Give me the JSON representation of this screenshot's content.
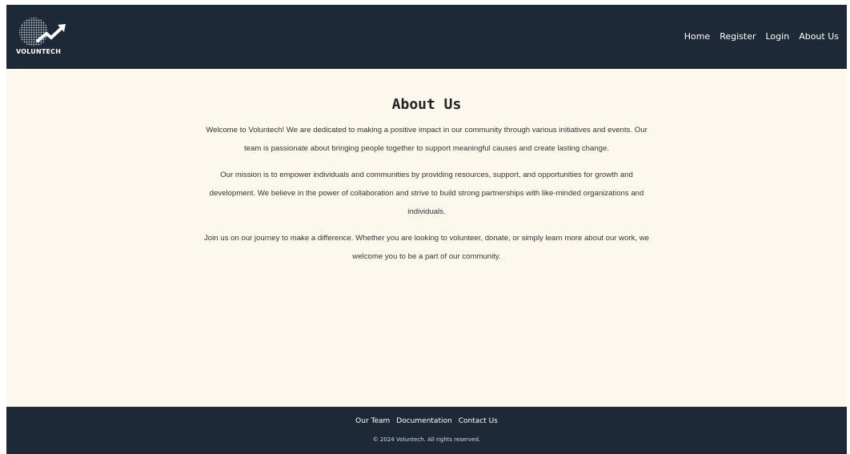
{
  "header": {
    "logo_text": "VOLUNTECH",
    "nav": {
      "home": "Home",
      "register": "Register",
      "login": "Login",
      "about": "About Us"
    }
  },
  "main": {
    "title": "About Us",
    "paragraphs": [
      "Welcome to Voluntech! We are dedicated to making a positive impact in our community through various initiatives and events. Our team is passionate about bringing people together to support meaningful causes and create lasting change.",
      "Our mission is to empower individuals and communities by providing resources, support, and opportunities for growth and development. We believe in the power of collaboration and strive to build strong partnerships with like-minded organizations and individuals.",
      "Join us on our journey to make a difference. Whether you are looking to volunteer, donate, or simply learn more about our work, we welcome you to be a part of our community."
    ]
  },
  "footer": {
    "links": {
      "team": "Our Team",
      "docs": "Documentation",
      "contact": "Contact Us"
    },
    "copyright": "© 2024 Voluntech. All rights reserved."
  },
  "colors": {
    "header_bg": "#1d2936",
    "page_bg": "#fcf8ee",
    "accent": "#ffffff"
  },
  "icons": {
    "logo": "globe-with-rising-arrow-icon"
  }
}
